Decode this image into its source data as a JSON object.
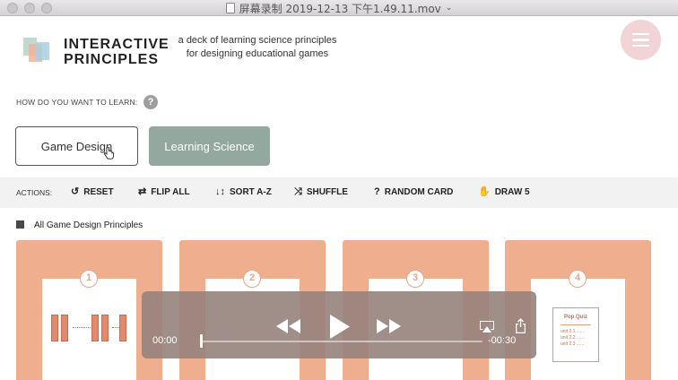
{
  "window": {
    "title": "屏幕录制 2019-12-13 下午1.49.11.mov"
  },
  "header": {
    "brand_line1": "INTERACTIVE",
    "brand_line2": "PRINCIPLES",
    "tagline_line1": "a deck of learning science principles",
    "tagline_line2": "for designing educational games"
  },
  "learn": {
    "question": "HOW DO YOU WANT TO LEARN:",
    "help": "?",
    "options": [
      "Game Design",
      "Learning Science"
    ],
    "selected": "Game Design"
  },
  "actions": {
    "label": "ACTIONS:",
    "items": [
      {
        "label": "RESET",
        "icon": "reset-icon",
        "glyph": "↺"
      },
      {
        "label": "FLIP ALL",
        "icon": "flip-icon",
        "glyph": "⇄"
      },
      {
        "label": "SORT A-Z",
        "icon": "sort-icon",
        "glyph": "↓↕"
      },
      {
        "label": "SHUFFLE",
        "icon": "shuffle-icon",
        "glyph": "⤨"
      },
      {
        "label": "RANDOM CARD",
        "icon": "question-icon",
        "glyph": "?"
      },
      {
        "label": "DRAW 5",
        "icon": "hand-icon",
        "glyph": "✋"
      }
    ]
  },
  "section": {
    "title": "All Game Design Principles"
  },
  "cards": [
    {
      "number": "1"
    },
    {
      "number": "2"
    },
    {
      "number": "3"
    },
    {
      "number": "4",
      "quiz_title": "Pop Quiz",
      "quiz_items": [
        "unit 2.1 ......",
        "unit 2.2 ......",
        "unit 2.3 ......"
      ]
    }
  ],
  "player": {
    "current_time": "00:00",
    "remaining_time": "-00:30",
    "progress": 0.0
  },
  "colors": {
    "card": "#efaf8f",
    "accent_green": "#93a89e",
    "menu_pink": "#f2d4d6",
    "bar_orange": "#e48a6c"
  }
}
